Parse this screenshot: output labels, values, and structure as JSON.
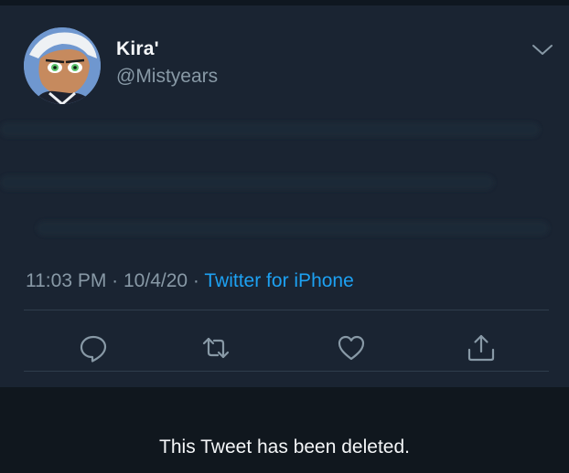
{
  "tweet": {
    "display_name": "Kira'",
    "handle": "@Mistyears",
    "time": "11:03 PM",
    "separator": " · ",
    "date": "10/4/20",
    "source": "Twitter for iPhone",
    "menu_icon": "chevron-down-icon",
    "actions": [
      {
        "name": "reply",
        "icon": "reply-icon"
      },
      {
        "name": "retweet",
        "icon": "retweet-icon"
      },
      {
        "name": "like",
        "icon": "heart-icon"
      },
      {
        "name": "share",
        "icon": "share-icon"
      }
    ]
  },
  "notice": {
    "text": "This Tweet has been deleted."
  },
  "colors": {
    "background": "#15202b",
    "card": "#1a2432",
    "text_primary": "#f4f6f8",
    "text_secondary": "#8899a6",
    "link": "#1da1f2",
    "icon": "#8899a6",
    "deleted_bar": "#10171e"
  }
}
